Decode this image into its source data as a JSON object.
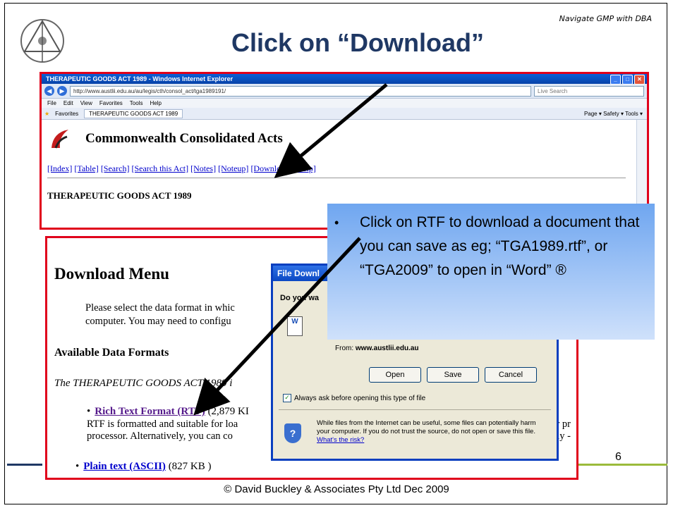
{
  "slide": {
    "nav_caption": "Navigate GMP with DBA",
    "title": "Click on “Download”",
    "page_number": "6",
    "footer": "© David Buckley & Associates Pty Ltd Dec 2009"
  },
  "browser": {
    "window_title": "THERAPEUTIC GOODS ACT 1989 - Windows Internet Explorer",
    "address": "http://www.austlii.edu.au/au/legis/cth/consol_act/tga1989191/",
    "search_placeholder": "Live Search",
    "menu": [
      "File",
      "Edit",
      "View",
      "Favorites",
      "Tools",
      "Help"
    ],
    "favorites_label": "Favorites",
    "tab_label": "THERAPEUTIC GOODS ACT 1989",
    "toolbar_right": "Page ▾  Safety ▾  Tools ▾",
    "site_heading": "Commonwealth Consolidated Acts",
    "nav_links": [
      "[Index]",
      "[Table]",
      "[Search]",
      "[Search this Act]",
      "[Notes]",
      "[Noteup]",
      "[Download]",
      "[Help]"
    ],
    "act_name": "THERAPEUTIC GOODS ACT 1989"
  },
  "download_page": {
    "heading": "Download Menu",
    "para_1": "Please select the data format in whic",
    "para_2": "computer. You may need to configu",
    "subheading": "Available Data Formats",
    "intro": "The THERAPEUTIC GOODS ACT 1989 i",
    "rtf_link": "Rich Text Format (RTF)",
    "rtf_size": " (2,879 KI",
    "rtf_desc_1": "RTF is formatted and suitable for loa",
    "rtf_desc_2": "processor. Alternatively, you can co",
    "rtf_tail_1": "r pr",
    "rtf_tail_2": "lly -",
    "ascii_link": "Plain text (ASCII)",
    "ascii_size": " (827 KB )"
  },
  "dialog": {
    "title": "File Downl",
    "question": "Do you wa",
    "from_label": "From:",
    "from_value": "www.austlii.edu.au",
    "open_label": "Open",
    "save_label": "Save",
    "cancel_label": "Cancel",
    "always_ask": "Always ask before opening this type of file",
    "warning_text": "While files from the Internet can be useful, some files can potentially harm your computer. If you do not trust the source, do not open or save this file.",
    "risk_link": "What's the risk?"
  },
  "callout": {
    "text": "Click on RTF to download a document that you can save as eg; “TGA1989.rtf”, or “TGA2009” to open in “Word” ®"
  },
  "colors": {
    "title": "#1f3864",
    "highlight_border": "#e0001b",
    "callout_top": "#6fa6f0",
    "callout_bottom": "#cfe1fb"
  }
}
